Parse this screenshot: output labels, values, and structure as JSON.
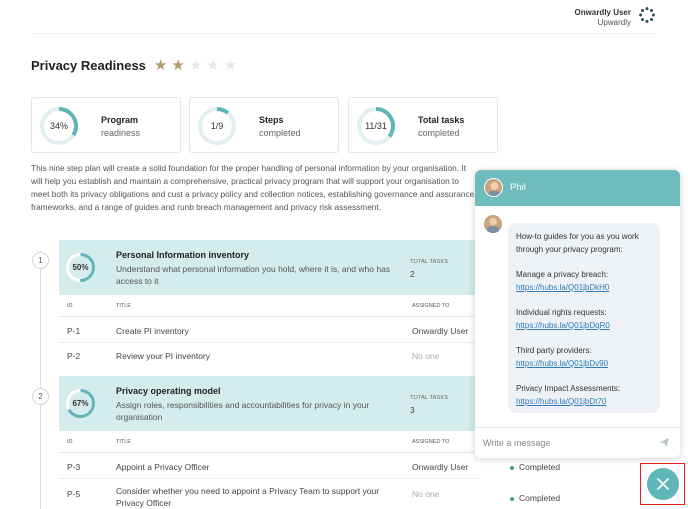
{
  "header": {
    "user_name": "Onwardly User",
    "org_name": "Upwardly",
    "logo_icon": "dotted-ring-logo"
  },
  "page": {
    "title": "Privacy Readiness",
    "rating": {
      "value": 2,
      "max": 5
    }
  },
  "colors": {
    "accent": "#5fb6b8",
    "star_filled": "#b39a6f",
    "star_empty": "#e8e8e8",
    "status_green": "#3aa57a",
    "header_band": "#d4ecec"
  },
  "stats": [
    {
      "value": "34%",
      "fraction": 0.34,
      "label1": "Program",
      "label2": "readiness"
    },
    {
      "value": "1/9",
      "fraction": 0.111,
      "label1": "Steps",
      "label2": "completed"
    },
    {
      "value": "11/31",
      "fraction": 0.355,
      "label1": "Total tasks",
      "label2": "completed"
    }
  ],
  "intro": "This nine step plan will create a solid foundation for the proper handling of personal information by your organisation. It will help you establish and maintain a comprehensive, practical privacy program that will support your organisation to meet both its privacy obligations and cust a privacy policy and collection notices, establishing governance and assurance frameworks, and a range of guides and runb breach management and privacy risk assessment.",
  "table_columns": {
    "id": "ID",
    "title": "TITLE",
    "assigned": "ASSIGNED TO"
  },
  "steps": [
    {
      "number": "1",
      "percent": "50%",
      "fraction": 0.5,
      "title": "Personal Information inventory",
      "description": "Understand what personal information you hold, where it is, and who has access to it",
      "tasks_label": "TOTAL TASKS",
      "tasks_value": "2",
      "rows": [
        {
          "id": "P-1",
          "title": "Create PI inventory",
          "assigned": "Onwardly User",
          "status": ""
        },
        {
          "id": "P-2",
          "title": "Review your PI inventory",
          "assigned": "No one",
          "status": ""
        }
      ]
    },
    {
      "number": "2",
      "percent": "67%",
      "fraction": 0.67,
      "title": "Privacy operating model",
      "description": "Assign roles, responsibilities and accountabilities for privacy in your organisation",
      "tasks_label": "TOTAL TASKS",
      "tasks_value": "3",
      "rows": [
        {
          "id": "P-3",
          "title": "Appoint a Privacy Officer",
          "assigned": "Onwardly User",
          "status": "Completed"
        },
        {
          "id": "P-5",
          "title": "Consider whether you need to appoint a Privacy Team to support your Privacy Officer",
          "assigned": "No one",
          "status": "Completed"
        }
      ]
    }
  ],
  "chat": {
    "agent_name": "Phil",
    "message_intro": "How-to guides for you as you work through your privacy program:",
    "guides": [
      {
        "label": "Manage a privacy breach:",
        "link": "https://hubs.la/Q01jbDkH0"
      },
      {
        "label": "Individual rights requests:",
        "link": "https://hubs.la/Q01jbDqR0"
      },
      {
        "label": "Third party providers:",
        "link": "https://hubs.la/Q01jbDv90"
      },
      {
        "label": "Privacy Impact Assessments:",
        "link": "https://hubs.la/Q01jbDt70"
      }
    ],
    "input_placeholder": "Write a message",
    "send_icon": "send-icon",
    "close_icon": "close-icon"
  }
}
